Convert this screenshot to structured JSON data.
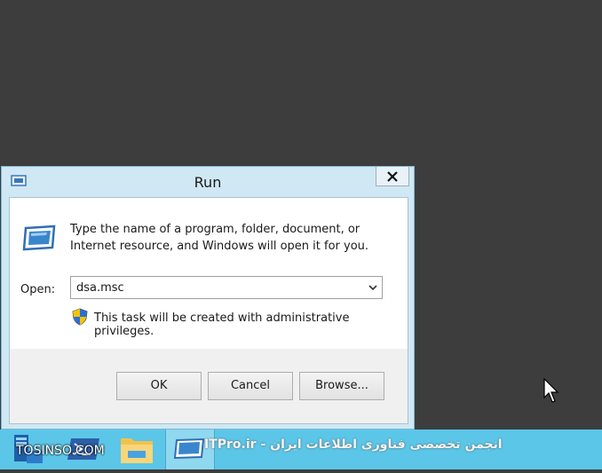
{
  "dialog": {
    "title": "Run",
    "description": "Type the name of a program, folder, document, or Internet resource, and Windows will open it for you.",
    "open_label": "Open:",
    "open_value": "dsa.msc",
    "admin_note": "This task will be created with administrative privileges.",
    "buttons": {
      "ok": "OK",
      "cancel": "Cancel",
      "browse": "Browse..."
    },
    "close_icon": "close-icon"
  },
  "taskbar": {
    "items": [
      "server-manager-icon",
      "powershell-icon",
      "file-explorer-icon",
      "run-icon"
    ],
    "color": "#5bc6e8"
  },
  "watermark": {
    "left": "TOSINSO.COM",
    "right": "ITPro.ir - انجمن تخصصی فناوری اطلاعات ایران"
  },
  "colors": {
    "desktop": "#3d3d3d",
    "window_frame": "#cfe8f4"
  }
}
